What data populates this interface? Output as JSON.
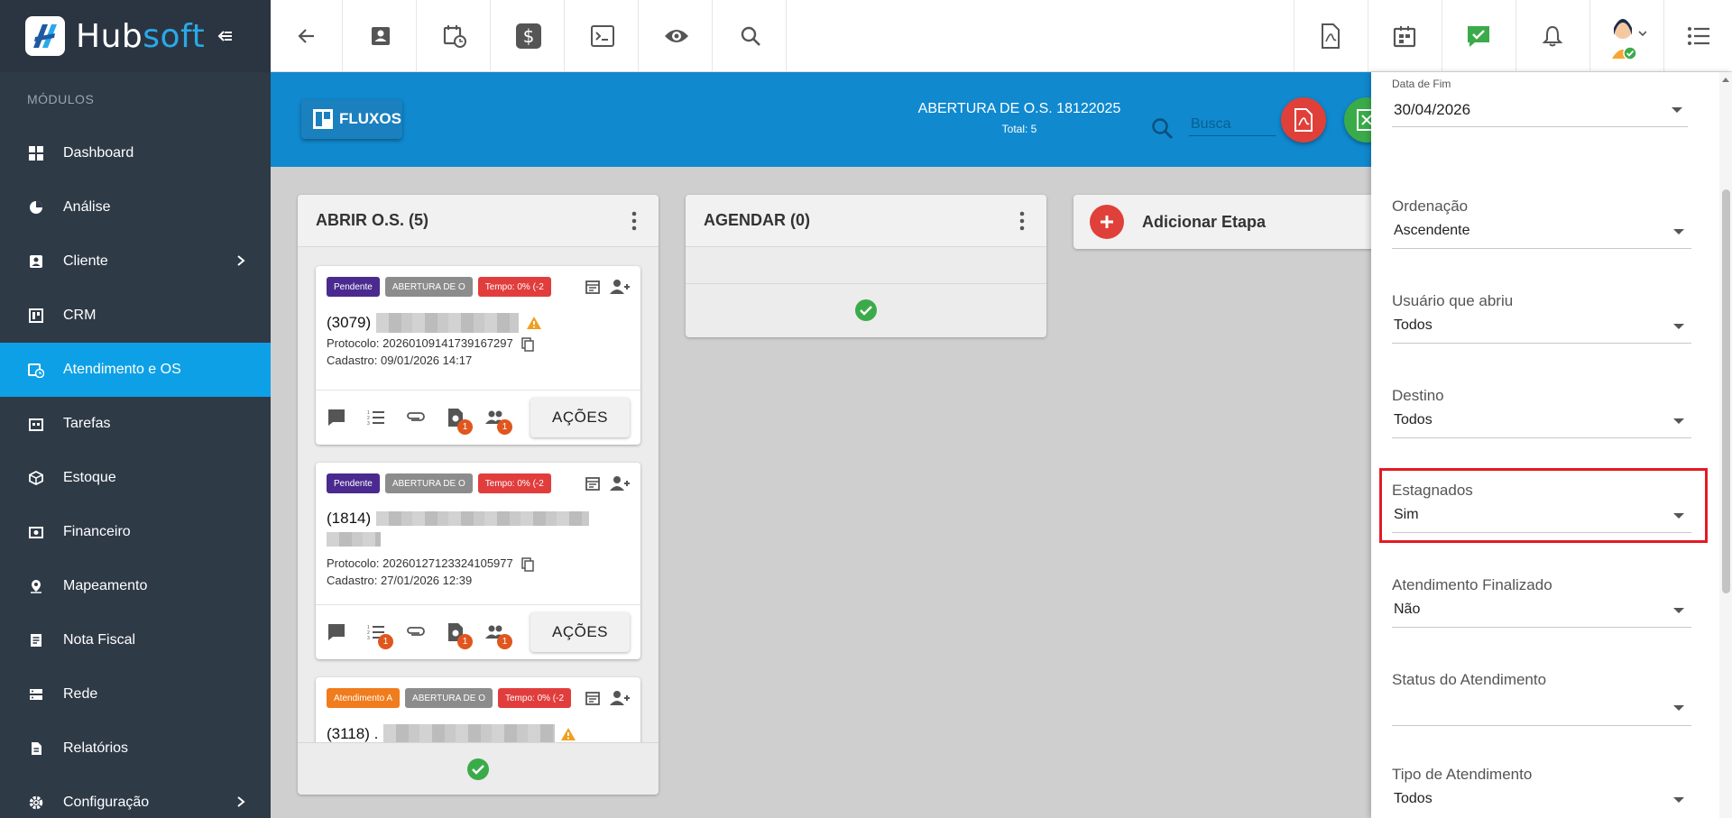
{
  "app": {
    "logo_text_1": "Hub",
    "logo_text_2": "soft"
  },
  "sidebar": {
    "modules_label": "MÓDULOS",
    "items": [
      {
        "label": "Dashboard",
        "icon": "dashboard-icon"
      },
      {
        "label": "Análise",
        "icon": "pie-chart-icon"
      },
      {
        "label": "Cliente",
        "icon": "contact-card-icon",
        "has_submenu": true
      },
      {
        "label": "CRM",
        "icon": "kanban-icon"
      },
      {
        "label": "Atendimento e OS",
        "icon": "calendar-clock-icon",
        "active": true
      },
      {
        "label": "Tarefas",
        "icon": "task-calendar-icon"
      },
      {
        "label": "Estoque",
        "icon": "box-icon"
      },
      {
        "label": "Financeiro",
        "icon": "money-icon"
      },
      {
        "label": "Mapeamento",
        "icon": "map-pin-icon"
      },
      {
        "label": "Nota Fiscal",
        "icon": "receipt-icon"
      },
      {
        "label": "Rede",
        "icon": "server-icon"
      },
      {
        "label": "Relatórios",
        "icon": "document-icon"
      },
      {
        "label": "Configuração",
        "icon": "gear-icon",
        "has_submenu": true
      }
    ]
  },
  "board": {
    "fluxos_label": "FLUXOS",
    "title": "ABERTURA DE O.S. 18122025",
    "subtitle": "Total: 5",
    "search_placeholder": "Busca",
    "columns": [
      {
        "title": "ABRIR O.S. (5)",
        "cards": [
          {
            "tags": [
              "Pendente",
              "ABERTURA DE O",
              "Tempo: 0% (-2"
            ],
            "code": "(3079)",
            "protocol": "Protocolo: 20260109141739167297",
            "created": "Cadastro: 09/01/2026 14:17",
            "action_label": "AÇÕES"
          },
          {
            "tags": [
              "Pendente",
              "ABERTURA DE O",
              "Tempo: 0% (-2"
            ],
            "code": "(1814)",
            "protocol": "Protocolo: 20260127123324105977",
            "created": "Cadastro: 27/01/2026 12:39",
            "action_label": "AÇÕES"
          },
          {
            "tags": [
              "Atendimento A",
              "ABERTURA DE O",
              "Tempo: 0% (-2"
            ],
            "code": "(3118) ."
          }
        ],
        "badge": "1"
      },
      {
        "title": "AGENDAR (0)"
      }
    ],
    "add_stage_label": "Adicionar Etapa"
  },
  "filters": {
    "date_end_label": "Data de Fim",
    "date_end_value": "30/04/2026",
    "fields": [
      {
        "label": "Ordenação",
        "value": "Ascendente"
      },
      {
        "label": "Usuário que abriu",
        "value": "Todos"
      },
      {
        "label": "Destino",
        "value": "Todos"
      },
      {
        "label": "Estagnados",
        "value": "Sim"
      },
      {
        "label": "Atendimento Finalizado",
        "value": "Não"
      },
      {
        "label": "Status do Atendimento",
        "value": ""
      },
      {
        "label": "Tipo de Atendimento",
        "value": "Todos"
      }
    ]
  },
  "colors": {
    "sidebar_bg": "#2f3a47",
    "active_item": "#0ea0e6",
    "header_band": "#1089cf",
    "highlight": "#e21b23",
    "tag_pending": "#4a2a8f",
    "tag_time": "#e23d3d",
    "tag_attending": "#f07c1d",
    "success": "#3bab4a"
  }
}
